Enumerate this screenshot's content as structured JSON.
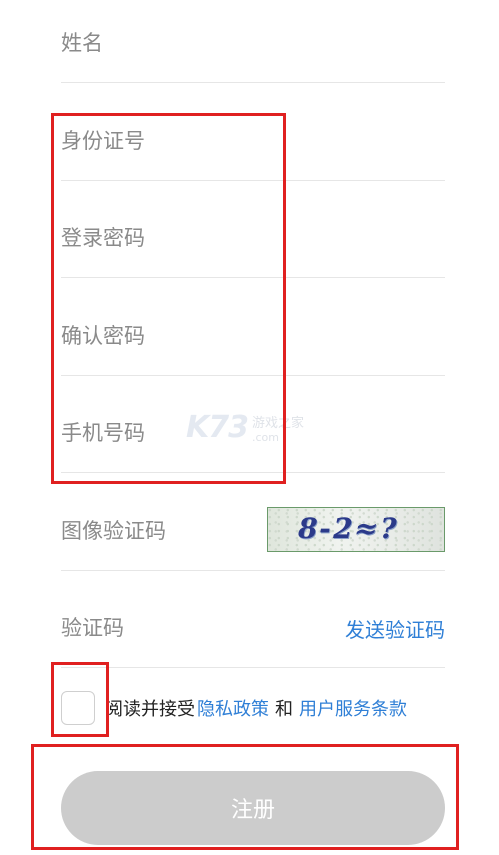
{
  "form": {
    "name_placeholder": "姓名",
    "id_placeholder": "身份证号",
    "password_placeholder": "登录密码",
    "confirm_placeholder": "确认密码",
    "phone_placeholder": "手机号码",
    "image_captcha_placeholder": "图像验证码",
    "captcha_text": "8-2≈?",
    "sms_code_placeholder": "验证码",
    "send_code_label": "发送验证码"
  },
  "agreement": {
    "checked": false,
    "prefix": "阅读并接受",
    "privacy_link": "隐私政策",
    "and": "和",
    "terms_link": "用户服务条款"
  },
  "register_button": "注册",
  "watermark": {
    "logo": "K73",
    "cn": "游戏之家",
    "com": ".com"
  },
  "colors": {
    "link": "#2f7fd6",
    "button_disabled": "#cccccc",
    "highlight": "#e02020"
  }
}
